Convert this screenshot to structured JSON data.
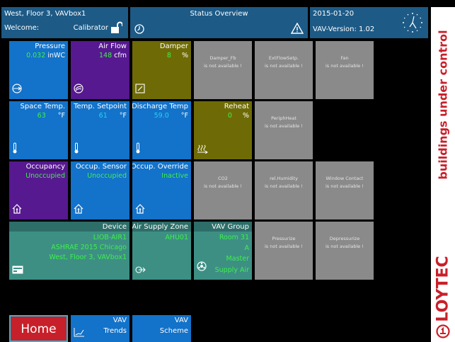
{
  "header": {
    "location": "West, Floor 3, VAVbox1",
    "welcome_label": "Welcome:",
    "user": "Calibrator",
    "status_title": "Status Overview",
    "date": "2015-01-20",
    "version": "VAV-Version: 1.02"
  },
  "tiles": {
    "pressure": {
      "title": "Pressure",
      "value": "0.032",
      "unit": "inWC"
    },
    "airflow": {
      "title": "Air Flow",
      "value": "148",
      "unit": "cfm"
    },
    "damper": {
      "title": "Damper",
      "value": "8",
      "unit": "%"
    },
    "damper_fb": {
      "name": "Damper_Fb",
      "status": "is not available !"
    },
    "extflow": {
      "name": "ExtFlowSetp.",
      "status": "is not available !"
    },
    "fan": {
      "name": "Fan",
      "status": "is not available !"
    },
    "space_temp": {
      "title": "Space Temp.",
      "value": "63",
      "unit": "°F"
    },
    "temp_setpoint": {
      "title": "Temp. Setpoint",
      "value": "61",
      "unit": "°F"
    },
    "discharge_temp": {
      "title": "Discharge Temp",
      "value": "59.0",
      "unit": "°F"
    },
    "reheat": {
      "title": "Reheat",
      "value": "0",
      "unit": "%"
    },
    "periphheat": {
      "name": "PeriphHeat",
      "status": "is not available !"
    },
    "occupancy": {
      "title": "Occupancy",
      "value": "Unoccupied"
    },
    "occ_sensor": {
      "title": "Occup. Sensor",
      "value": "Unoccupied"
    },
    "occ_override": {
      "title": "Occup. Override",
      "value": "Inactive"
    },
    "co2": {
      "name": "CO2",
      "status": "is not available !"
    },
    "humidity": {
      "name": "rel.Humidity",
      "status": "is not available !"
    },
    "window": {
      "name": "Window Contact",
      "status": "is not available !"
    },
    "device": {
      "title": "Device",
      "lines": [
        "LIOB-AIR1",
        "ASHRAE 2015 Chicago",
        "West, Floor 3, VAVbox1"
      ]
    },
    "air_supply": {
      "title": "Air Supply Zone",
      "value": "AHU01"
    },
    "vav_group": {
      "title": "VAV Group",
      "lines": [
        "Room 31",
        "A",
        "Master",
        "Supply Air"
      ]
    },
    "pressurize": {
      "name": "Pressurize",
      "status": "is not available !"
    },
    "depressurize": {
      "name": "Depressurize",
      "status": "is not available !"
    }
  },
  "nav": {
    "home": "Home",
    "trends_line1": "VAV",
    "trends_line2": "Trends",
    "scheme_line1": "VAV",
    "scheme_line2": "Scheme"
  },
  "sidebar": {
    "tagline": "buildings under control",
    "brand": "LOYTEC"
  },
  "colors": {
    "tile_blue": "#1372c9",
    "tile_purple": "#56198f",
    "tile_olive": "#6e6b06",
    "tile_teal": "#3d8f84",
    "tile_unavailable": "#8a8a8a",
    "value_green": "#3ef04a",
    "value_cyan": "#25d3f0",
    "brand_red": "#c8202a",
    "header_blue": "#1d5a86"
  },
  "icons": [
    "lock-open-icon",
    "clock-icon",
    "warning-icon",
    "analog-clock-icon",
    "pressure-gauge-icon",
    "airflow-icon",
    "damper-icon",
    "thermometer-icon",
    "heater-icon",
    "occupancy-house-icon",
    "device-card-icon",
    "air-supply-icon",
    "vav-group-icon",
    "trend-chart-icon",
    "loytec-logo-icon"
  ]
}
